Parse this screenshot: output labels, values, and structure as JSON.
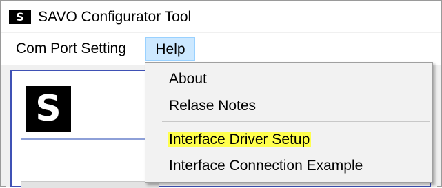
{
  "window": {
    "title": "SAVO Configurator Tool",
    "icon_letter": "S"
  },
  "menubar": {
    "items": [
      {
        "label": "Com Port Setting"
      },
      {
        "label": "Help"
      }
    ]
  },
  "logo": {
    "letter": "S"
  },
  "help_menu": {
    "items": [
      {
        "label": "About"
      },
      {
        "label": "Relase Notes"
      },
      {
        "label": "Interface Driver Setup",
        "highlighted": true
      },
      {
        "label": "Interface Connection Example"
      }
    ]
  },
  "colors": {
    "highlight": "#ffff4d",
    "menu_active_bg": "#cce8ff",
    "panel_border": "#3f51b5"
  }
}
